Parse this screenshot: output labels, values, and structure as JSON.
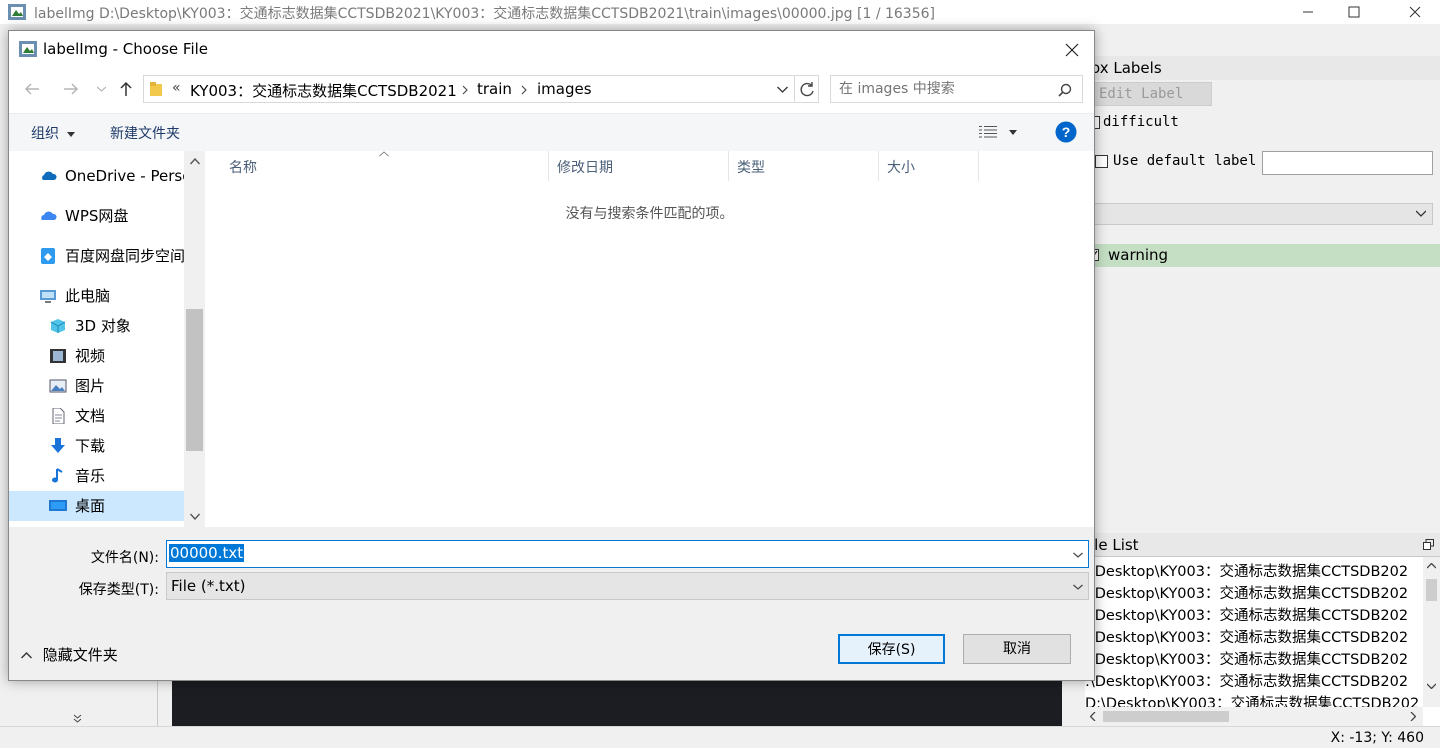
{
  "main_window": {
    "title": "labelImg D:\\Desktop\\KY003：交通标志数据集CCTSDB2021\\KY003：交通标志数据集CCTSDB2021\\train\\images\\00000.jpg [1 / 16356]",
    "status": "X: -13; Y: 460"
  },
  "dock": {
    "box_labels_title": "ox Labels",
    "edit_label_button": "Edit Label",
    "difficult_label": "difficult",
    "use_default_label": "Use default label",
    "default_label_value": "",
    "label_items": [
      "warning"
    ],
    "file_list_title": "ile List",
    "file_list_items": [
      ":\\Desktop\\KY003：交通标志数据集CCTSDB202",
      ":\\Desktop\\KY003：交通标志数据集CCTSDB202",
      ":\\Desktop\\KY003：交通标志数据集CCTSDB202",
      ":\\Desktop\\KY003：交通标志数据集CCTSDB202",
      ":\\Desktop\\KY003：交通标志数据集CCTSDB202",
      ":\\Desktop\\KY003：交通标志数据集CCTSDB202",
      "D:\\Desktop\\KY003：交通标志数据集CCTSDB202"
    ]
  },
  "dialog": {
    "title": "labelImg - Choose File",
    "breadcrumb": [
      "KY003：交通标志数据集CCTSDB2021",
      "train",
      "images"
    ],
    "breadcrumb_prefix": "«",
    "search_placeholder": "在 images 中搜索",
    "toolbar": {
      "organize": "组织",
      "new_folder": "新建文件夹"
    },
    "nav_items": [
      {
        "label": "OneDrive - Personal",
        "icon": "onedrive-icon"
      },
      {
        "label": "WPS网盘",
        "icon": "wps-cloud-icon"
      },
      {
        "label": "百度网盘同步空间",
        "icon": "baidu-netdisk-icon"
      },
      {
        "label": "此电脑",
        "icon": "this-pc-icon"
      },
      {
        "label": "3D 对象",
        "icon": "3d-objects-icon"
      },
      {
        "label": "视频",
        "icon": "videos-icon"
      },
      {
        "label": "图片",
        "icon": "pictures-icon"
      },
      {
        "label": "文档",
        "icon": "documents-icon"
      },
      {
        "label": "下载",
        "icon": "downloads-icon"
      },
      {
        "label": "音乐",
        "icon": "music-icon"
      },
      {
        "label": "桌面",
        "icon": "desktop-icon"
      }
    ],
    "columns": [
      "名称",
      "修改日期",
      "类型",
      "大小"
    ],
    "empty_message": "没有与搜索条件匹配的项。",
    "filename_label": "文件名(N):",
    "filename_value": "00000.txt",
    "filetype_label": "保存类型(T):",
    "filetype_value": "File (*.txt)",
    "hide_folders": "隐藏文件夹",
    "save_button": "保存(S)",
    "cancel_button": "取消"
  },
  "colors": {
    "selection": "#0078d7",
    "label_row": "#c4dfc4",
    "help_icon": "#0066cc",
    "folder": "#f2c94c"
  }
}
